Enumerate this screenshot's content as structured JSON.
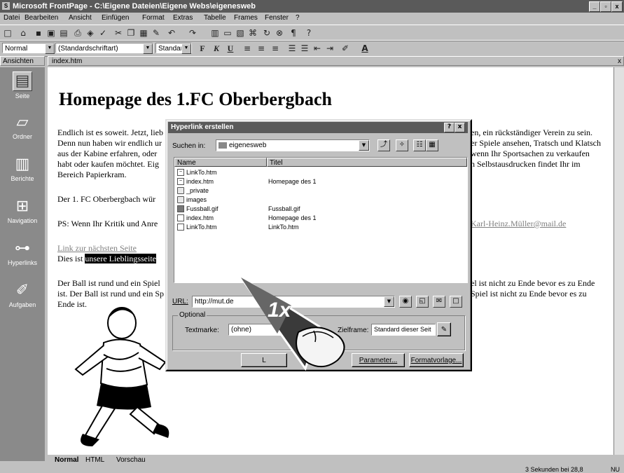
{
  "window": {
    "title": "Microsoft FrontPage - C:\\Eigene Dateien\\Eigene Webs\\eigenesweb",
    "min": "_",
    "max": "▫",
    "close": "x"
  },
  "menu": [
    "Datei",
    "Bearbeiten",
    "Ansicht",
    "Einfügen",
    "Format",
    "Extras",
    "Tabelle",
    "Frames",
    "Fenster",
    "?"
  ],
  "format_toolbar": {
    "style": "Normal",
    "font": "(Standardschriftart)",
    "size": "Standard",
    "bold": "F",
    "italic": "K",
    "underline": "U"
  },
  "panels": {
    "views_header": "Ansichten",
    "file_tab": "index.htm",
    "close": "x"
  },
  "views": [
    "Seite",
    "Ordner",
    "Berichte",
    "Navigation",
    "Hyperlinks",
    "Aufgaben"
  ],
  "page": {
    "heading": "Homepage des 1.FC Oberbergbach",
    "p1_l1": "Endlich ist es soweit. Jetzt, lieb",
    "p1_l2": "Denn nun haben wir endlich ur",
    "p1_l3": "aus der Kabine erfahren, oder",
    "p1_l4": "habt oder kaufen möchtet. Eig",
    "p1_l5": "Bereich Papierkram.",
    "p1_r1": "en, ein rückständiger Verein zu sein.",
    "p1_r2": "er Spiele ansehen, Tratsch und Klatsch",
    "p1_r3": "wenn Ihr Sportsachen zu verkaufen",
    "p1_r4": "n Selbstausdrucken findet Ihr im",
    "p2": "Der 1. FC Oberbergbach wür",
    "p3": "PS: Wenn Ihr Kritik und Anre",
    "p3_link": "Karl-Heinz.Müller@mail.de",
    "link_next": "Link zur nächsten Seite",
    "fav_prefix": "Dies ist ",
    "fav_sel": "unsere Lieblingsseite",
    "p4_l1": "Der Ball ist rund und ein Spiel",
    "p4_l2": "ist. Der Ball ist rund und ein Sp",
    "p4_l3": "Ende ist.",
    "p4_r1": "el ist nicht zu Ende bevor es zu Ende",
    "p4_r2": "Spiel ist nicht zu Ende bevor es zu"
  },
  "view_tabs": [
    "Normal",
    "HTML",
    "Vorschau"
  ],
  "status": {
    "text": "3 Sekunden bei 28,8",
    "nu": "NU"
  },
  "dialog": {
    "title": "Hyperlink erstellen",
    "help": "?",
    "close": "x",
    "lookin_label": "Suchen in:",
    "lookin_value": "eigenesweb",
    "col_name": "Name",
    "col_title": "Titel",
    "files": [
      {
        "name": "LinkTo.htm",
        "title": "",
        "kind": "page"
      },
      {
        "name": "index.htm",
        "title": "Homepage des 1",
        "kind": "page"
      },
      {
        "name": "_private",
        "title": "",
        "kind": "folder"
      },
      {
        "name": "images",
        "title": "",
        "kind": "folder"
      },
      {
        "name": "Fussball.gif",
        "title": "Fussball.gif",
        "kind": "image"
      },
      {
        "name": "index.htm",
        "title": "Homepage des 1",
        "kind": "page"
      },
      {
        "name": "LinkTo.htm",
        "title": "LinkTo.htm",
        "kind": "page"
      }
    ],
    "url_label": "URL:",
    "url_value": "http://mut.de",
    "optional_label": "Optional",
    "bookmark_label": "Textmarke:",
    "bookmark_value": "(ohne)",
    "target_label": "Zielframe:",
    "target_value": "Standard dieser Seit",
    "ok": "L",
    "params": "Parameter...",
    "style": "Formatvorlage..."
  },
  "callout": "1x"
}
